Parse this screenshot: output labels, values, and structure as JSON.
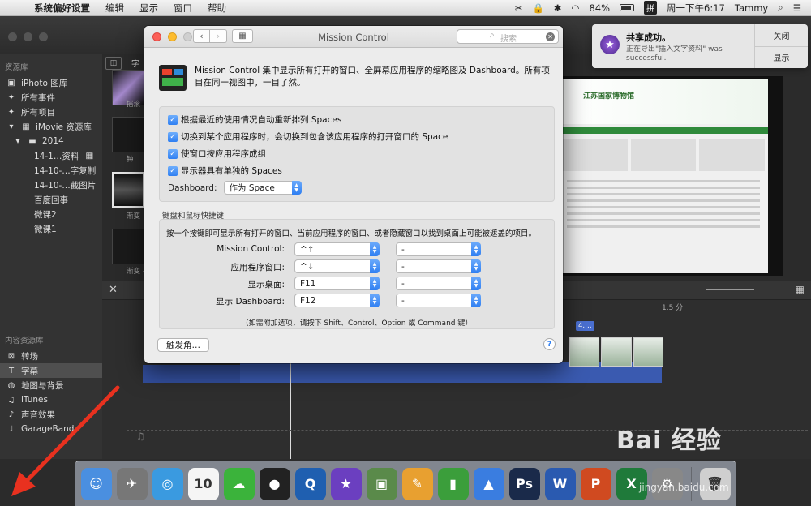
{
  "menubar": {
    "app": "系统偏好设置",
    "items": [
      "编辑",
      "显示",
      "窗口",
      "帮助"
    ],
    "battery": "84%",
    "ime": "拼",
    "clock": "周一下午6:17",
    "user": "Tammy"
  },
  "library": {
    "section": "资源库",
    "items": [
      {
        "label": "iPhoto 图库",
        "icon": "photo-icon"
      },
      {
        "label": "所有事件",
        "icon": "star-icon"
      },
      {
        "label": "所有项目",
        "icon": "star-icon"
      },
      {
        "label": "iMovie 资源库",
        "icon": "film-icon"
      },
      {
        "label": "2014",
        "icon": "folder-icon"
      },
      {
        "label": "14-1…资料",
        "icon": ""
      },
      {
        "label": "14-10-…字复制",
        "icon": ""
      },
      {
        "label": "14-10-…截图片",
        "icon": ""
      },
      {
        "label": "百度回事",
        "icon": ""
      },
      {
        "label": "微课2",
        "icon": ""
      },
      {
        "label": "微课1",
        "icon": ""
      }
    ],
    "content_section": "内容资源库",
    "content_items": [
      {
        "label": "转场",
        "icon": "transition-icon"
      },
      {
        "label": "字幕",
        "icon": "title-icon"
      },
      {
        "label": "地图与背景",
        "icon": "globe-icon"
      },
      {
        "label": "iTunes",
        "icon": "music-icon"
      },
      {
        "label": "声音效果",
        "icon": "speaker-icon"
      },
      {
        "label": "GarageBand",
        "icon": "guitar-icon"
      }
    ]
  },
  "thumbs": [
    "摇滚",
    "钟",
    "渐变",
    "渐变 - "
  ],
  "imovie_tabs": [
    "字幕"
  ],
  "timeline": {
    "ruler_label": "1.5 分",
    "clip_tag": "4.…"
  },
  "viewer": {
    "site_title": "江苏国家博物馆"
  },
  "notification": {
    "title": "共享成功。",
    "message": "正在导出\"插入文字资料\" was successful.",
    "close_btn": "关闭",
    "show_btn": "显示"
  },
  "window": {
    "title": "Mission Control",
    "search_placeholder": "搜索",
    "description": "Mission Control 集中显示所有打开的窗口、全屏幕应用程序的缩略图及 Dashboard。所有项目在同一视图中，一目了然。",
    "checkboxes": [
      {
        "label": "根据最近的使用情况自动重新排列 Spaces",
        "checked": true
      },
      {
        "label": "切换到某个应用程序时，会切换到包含该应用程序的打开窗口的 Space",
        "checked": true
      },
      {
        "label": "使窗口按应用程序成组",
        "checked": true
      },
      {
        "label": "显示器具有单独的 Spaces",
        "checked": true
      }
    ],
    "dashboard_label": "Dashboard:",
    "dashboard_value": "作为 Space",
    "shortcuts_section": "键盘和鼠标快捷键",
    "shortcuts_desc": "按一个按键即可显示所有打开的窗口、当前应用程序的窗口、或者隐藏窗口以找到桌面上可能被遮盖的项目。",
    "shortcuts": [
      {
        "label": "Mission Control:",
        "key": "^↑",
        "mouse": "-"
      },
      {
        "label": "应用程序窗口:",
        "key": "^↓",
        "mouse": "-"
      },
      {
        "label": "显示桌面:",
        "key": "F11",
        "mouse": "-"
      },
      {
        "label": "显示 Dashboard:",
        "key": "F12",
        "mouse": "-"
      }
    ],
    "shortcuts_note": "（如需附加选项，请按下 Shift、Control、Option 或 Command 键）",
    "hot_corners": "触发角…",
    "help": "?"
  },
  "dock": [
    {
      "name": "Finder",
      "icon": "finder-icon",
      "color": "#4a8fe0",
      "glyph": "☺"
    },
    {
      "name": "Launchpad",
      "icon": "rocket-icon",
      "color": "#777",
      "glyph": "✈"
    },
    {
      "name": "Safari",
      "icon": "compass-icon",
      "color": "#3a9ae0",
      "glyph": "◎"
    },
    {
      "name": "Calendar",
      "icon": "calendar-icon",
      "color": "#f5f5f5",
      "glyph": "10"
    },
    {
      "name": "WeChat",
      "icon": "wechat-icon",
      "color": "#3bb33b",
      "glyph": "☁"
    },
    {
      "name": "QQ",
      "icon": "penguin-icon",
      "color": "#222",
      "glyph": "●"
    },
    {
      "name": "QuickTime",
      "icon": "quicktime-icon",
      "color": "#1f5fb0",
      "glyph": "Q"
    },
    {
      "name": "iMovie",
      "icon": "imovie-star-icon",
      "color": "#6b3fc0",
      "glyph": "★"
    },
    {
      "name": "Preview",
      "icon": "preview-icon",
      "color": "#5a8a4a",
      "glyph": "▣"
    },
    {
      "name": "Pages",
      "icon": "pages-icon",
      "color": "#e8a030",
      "glyph": "✎"
    },
    {
      "name": "Numbers",
      "icon": "numbers-icon",
      "color": "#3b9e3b",
      "glyph": "▮"
    },
    {
      "name": "Keynote",
      "icon": "keynote-icon",
      "color": "#3a7de0",
      "glyph": "▲"
    },
    {
      "name": "Photoshop",
      "icon": "photoshop-icon",
      "color": "#1a2a4a",
      "glyph": "Ps"
    },
    {
      "name": "Word",
      "icon": "word-icon",
      "color": "#2a5ab0",
      "glyph": "W"
    },
    {
      "name": "PowerPoint",
      "icon": "powerpoint-icon",
      "color": "#d04a20",
      "glyph": "P"
    },
    {
      "name": "Excel",
      "icon": "excel-icon",
      "color": "#1f7a3a",
      "glyph": "X"
    },
    {
      "name": "System Preferences",
      "icon": "gear-icon",
      "color": "#888",
      "glyph": "⚙"
    },
    {
      "name": "Trash",
      "icon": "trash-icon",
      "color": "#cfcfcf",
      "glyph": "🗑"
    }
  ],
  "watermark": {
    "brand": "Bai 经验",
    "url": "jingyan.baidu.com"
  }
}
